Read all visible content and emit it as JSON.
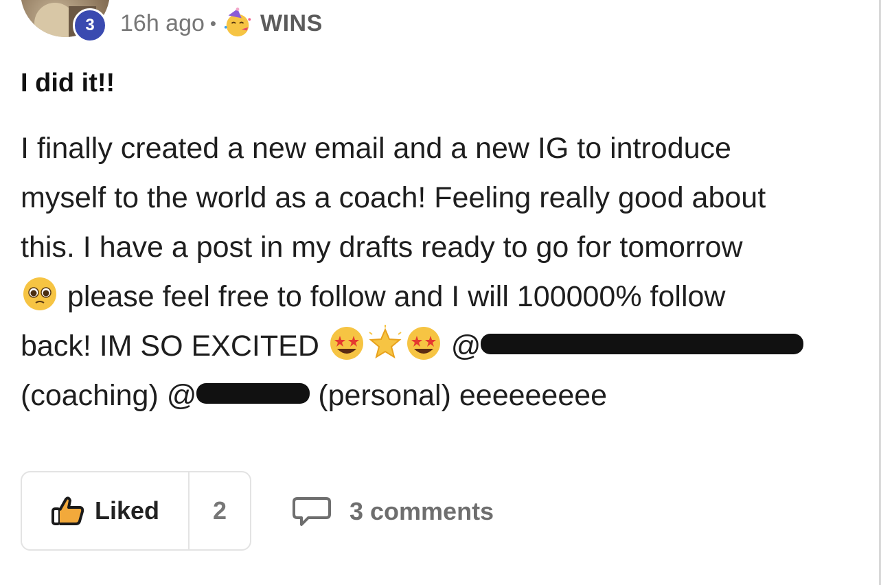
{
  "header": {
    "level": "3",
    "time": "16h ago",
    "separator": "•",
    "category": "WINS",
    "category_icon": "party-face-icon",
    "avatar_icon": "avatar-photo"
  },
  "post": {
    "title": "I did it!!",
    "lines": {
      "l1": "I finally created a new email and a new IG to introduce",
      "l2": "myself to the world as a coach! Feeling really good about",
      "l3": "this. I have a post in my drafts ready to go for tomorrow",
      "l4": "please feel free to follow and I will 100000% follow",
      "l5": "back! IM SO EXCITED",
      "l6a": "(coaching)",
      "l6b": "(personal) eeeeeeeee"
    },
    "at": "@",
    "emojis": [
      "pleading-face-icon",
      "star-struck-icon",
      "glowing-star-icon",
      "star-struck-icon"
    ]
  },
  "actions": {
    "like_label": "Liked",
    "like_count": "2",
    "comments_label": "3 comments"
  },
  "colors": {
    "badge": "#3a4ab0",
    "meta_text": "#767676",
    "border": "#e3e3e3"
  }
}
